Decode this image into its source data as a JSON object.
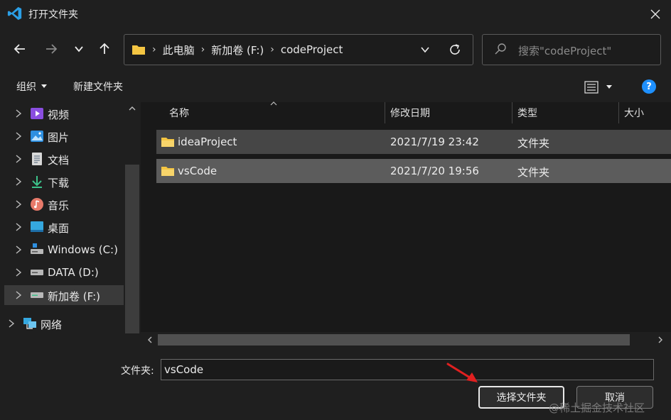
{
  "window": {
    "title": "打开文件夹",
    "close_icon": "close-icon"
  },
  "nav": {
    "back_icon": "arrow-left-icon",
    "forward_icon": "arrow-right-icon",
    "recent_icon": "chevron-down-icon",
    "up_icon": "arrow-up-icon"
  },
  "address": {
    "crumbs": [
      "此电脑",
      "新加卷 (F:)",
      "codeProject"
    ],
    "folder_icon": "folder-icon"
  },
  "search": {
    "placeholder": "搜索\"codeProject\""
  },
  "toolbar": {
    "organize": "组织",
    "new_folder": "新建文件夹",
    "help": "?"
  },
  "sidebar": {
    "items": [
      {
        "label": "视频",
        "icon": "video-icon"
      },
      {
        "label": "图片",
        "icon": "picture-icon"
      },
      {
        "label": "文档",
        "icon": "document-icon"
      },
      {
        "label": "下载",
        "icon": "download-icon"
      },
      {
        "label": "音乐",
        "icon": "music-icon"
      },
      {
        "label": "桌面",
        "icon": "desktop-icon"
      },
      {
        "label": "Windows (C:)",
        "icon": "drive-icon"
      },
      {
        "label": "DATA (D:)",
        "icon": "drive-icon"
      },
      {
        "label": "新加卷 (F:)",
        "icon": "drive-icon"
      },
      {
        "label": "网络",
        "icon": "network-icon"
      }
    ]
  },
  "columns": {
    "name": "名称",
    "modified": "修改日期",
    "type": "类型",
    "size": "大小"
  },
  "files": [
    {
      "name": "ideaProject",
      "modified": "2021/7/19 23:42",
      "type": "文件夹"
    },
    {
      "name": "vsCode",
      "modified": "2021/7/20 19:56",
      "type": "文件夹"
    }
  ],
  "footer": {
    "folder_label": "文件夹:",
    "folder_value": "vsCode",
    "select_button": "选择文件夹",
    "cancel_button": "取消",
    "watermark": "@稀土掘金技术社区"
  },
  "colors": {
    "accent": "#1e90ff",
    "folder": "#f4c542",
    "arrow": "#e02020"
  }
}
